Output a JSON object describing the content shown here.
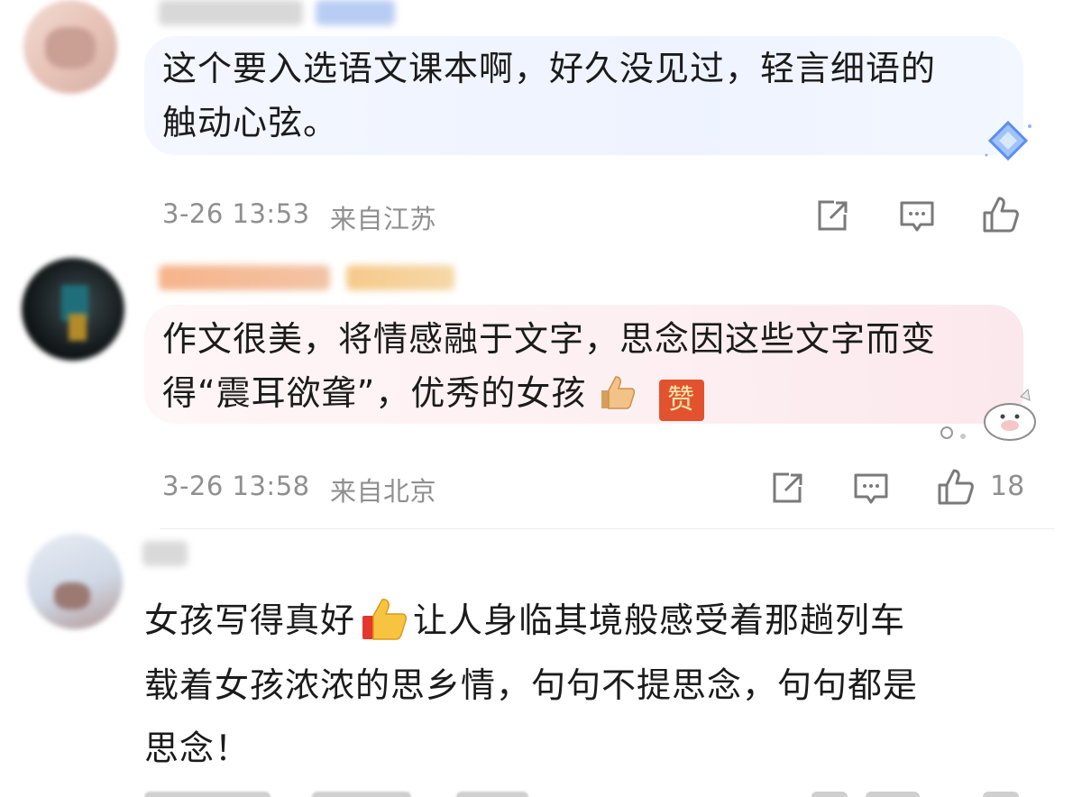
{
  "comments": [
    {
      "text_lines": [
        "这个要入选语文课本啊，好久没见过，轻言细语的",
        "触动心弦。"
      ],
      "time": "3-26 13:53",
      "location": "来自江苏",
      "likes": ""
    },
    {
      "text_lines": [
        "作文很美，将情感融于文字，思念因这些文字而变",
        "得“震耳欲聋”，优秀的女孩"
      ],
      "badge": "赞",
      "time": "3-26 13:58",
      "location": "来自北京",
      "likes": "18"
    },
    {
      "text_line1_a": "女孩写得真好",
      "text_line1_b": "让人身临其境般感受着那趟列车",
      "text_line2": "载着女孩浓浓的思乡情，句句不提思念，句句都是",
      "text_line3": "思念！"
    }
  ],
  "colors": {
    "bubble1": "#eef3ff",
    "bubble2": "#fdeff2",
    "meta": "#8f8f8f"
  },
  "icons": [
    "share-icon",
    "comment-icon",
    "thumbs-up-icon",
    "thumbs-up-emoji",
    "diamond-badge-icon",
    "cartoon-sticker"
  ]
}
